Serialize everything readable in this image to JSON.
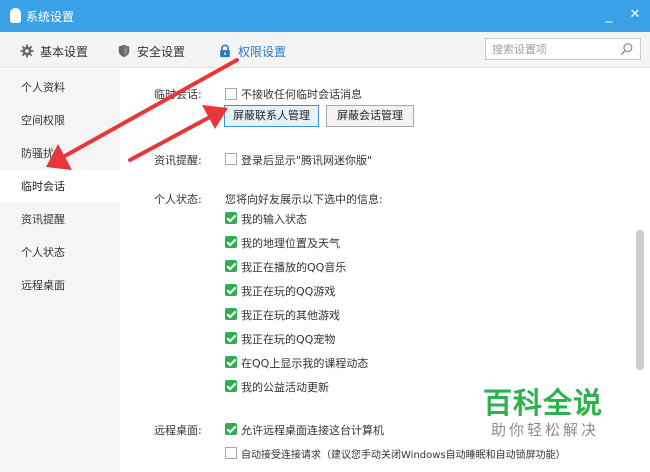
{
  "window": {
    "title": "系统设置",
    "minimize": "_",
    "close": "✕"
  },
  "tabs": [
    {
      "label": "基本设置",
      "icon": "gear-icon"
    },
    {
      "label": "安全设置",
      "icon": "shield-icon"
    },
    {
      "label": "权限设置",
      "icon": "lock-icon",
      "active": true
    }
  ],
  "search": {
    "placeholder": "搜索设置项"
  },
  "sidebar": {
    "items": [
      {
        "label": "个人资料"
      },
      {
        "label": "空间权限"
      },
      {
        "label": "防骚扰"
      },
      {
        "label": "临时会话",
        "active": true
      },
      {
        "label": "资讯提醒"
      },
      {
        "label": "个人状态"
      },
      {
        "label": "远程桌面"
      }
    ]
  },
  "temp_chat": {
    "label": "临时会话:",
    "reject_label": "不接收任何临时会话消息",
    "reject_checked": false,
    "block_contacts_btn": "屏蔽联系人管理",
    "block_sessions_btn": "屏蔽会话管理"
  },
  "news": {
    "label": "资讯提醒:",
    "show_mini_label": "登录后显示\"腾讯网迷你版\"",
    "show_mini_checked": false
  },
  "status": {
    "label": "个人状态:",
    "intro": "您将向好友展示以下选中的信息:",
    "items": [
      {
        "label": "我的输入状态",
        "checked": true
      },
      {
        "label": "我的地理位置及天气",
        "checked": true
      },
      {
        "label": "我正在播放的QQ音乐",
        "checked": true
      },
      {
        "label": "我正在玩的QQ游戏",
        "checked": true
      },
      {
        "label": "我正在玩的其他游戏",
        "checked": true
      },
      {
        "label": "我正在玩的QQ宠物",
        "checked": true
      },
      {
        "label": "在QQ上显示我的课程动态",
        "checked": true
      },
      {
        "label": "我的公益活动更新",
        "checked": true
      }
    ]
  },
  "remote": {
    "label": "远程桌面:",
    "allow_label": "允许远程桌面连接这台计算机",
    "allow_checked": true,
    "auto_accept_label": "自动接受连接请求（建议您手动关闭Windows自动睡眠和自动锁屏功能）",
    "auto_accept_checked": false
  },
  "watermark": {
    "title": "百科全说",
    "subtitle": "助你轻松解决"
  },
  "colors": {
    "titlebar": "#3aa1e6",
    "accent": "#1e7ccd",
    "check": "#2eae4c",
    "arrow": "#e8373a",
    "watermark": "#2bb24c"
  }
}
